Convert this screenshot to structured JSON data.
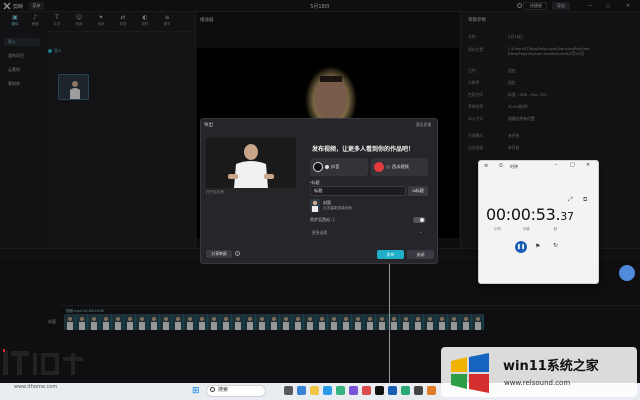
{
  "app": {
    "name": "剪映",
    "menu_label": "菜单",
    "window_title": "5月18日"
  },
  "topbar": {
    "shortcut_label": "快捷键",
    "export_label": "导出",
    "minimize": "—",
    "maximize": "▢",
    "close": "✕"
  },
  "left_nav": [
    "导入",
    "我的项目",
    "云素材",
    "素材库"
  ],
  "top_tabs": [
    {
      "label": "媒体",
      "icon": "▣"
    },
    {
      "label": "音频",
      "icon": "♪"
    },
    {
      "label": "文本",
      "icon": "T"
    },
    {
      "label": "贴纸",
      "icon": "☺"
    },
    {
      "label": "特效",
      "icon": "✦"
    },
    {
      "label": "转场",
      "icon": "⇄"
    },
    {
      "label": "滤镜",
      "icon": "◐"
    },
    {
      "label": "调节",
      "icon": "≡"
    }
  ],
  "media": {
    "import_label": "导入"
  },
  "player": {
    "title": "播放器"
  },
  "props": {
    "title": "草稿参数",
    "rows": [
      {
        "k": "名称",
        "v": "5月18日"
      },
      {
        "k": "保存位置",
        "v": "C:/Users/IT/AppData/Local/JianyingPro/User Data/Projects/com.lveditor.draft/5月18日"
      },
      {
        "k": "比例",
        "v": "适应"
      },
      {
        "k": "分辨率",
        "v": "适应"
      },
      {
        "k": "色彩空间",
        "v": "标准 - SDR - Rec.709"
      },
      {
        "k": "草稿帧率",
        "v": "30.00帧/秒"
      },
      {
        "k": "导入方式",
        "v": "保留在原有位置"
      },
      {
        "k": "代理模式",
        "v": "未开启"
      },
      {
        "k": "自由层级",
        "v": "未开启"
      }
    ]
  },
  "timeline": {
    "clip_label": "视频.mp4  00:00:20:00",
    "cover_label": "封面"
  },
  "export_dialog": {
    "title": "导出",
    "feedback": "意见反馈",
    "open_folder": "打开文件夹",
    "heading": "发布视频，让更多人看到你的作品吧！",
    "platforms": [
      {
        "name": "抖音",
        "color": "#111111",
        "dot": "#e0e0e0"
      },
      {
        "name": "西瓜视频",
        "color": "#e23b3b",
        "dot": "#555555"
      }
    ],
    "title_label": "*标题",
    "title_value": "标题",
    "ai_title_label": "AI标题",
    "cover_t1": "封面",
    "cover_t2": "点击重新选择封面",
    "sync_label": "同步至西瓜 ⓘ",
    "more_label": "更多选项",
    "share_review_label": "分享审阅",
    "publish_label": "发布",
    "close_label": "关闭"
  },
  "clock": {
    "title": "时钟",
    "time_main": "00:00:53.",
    "time_ms": "37",
    "units": [
      "小时",
      "分钟",
      "秒"
    ]
  },
  "taskbar": {
    "search_text": "搜索"
  },
  "watermark": {
    "ithome_url": "www.ithome.com",
    "relsound_main": "win11系统之家",
    "relsound_url": "www.relsound.com"
  }
}
